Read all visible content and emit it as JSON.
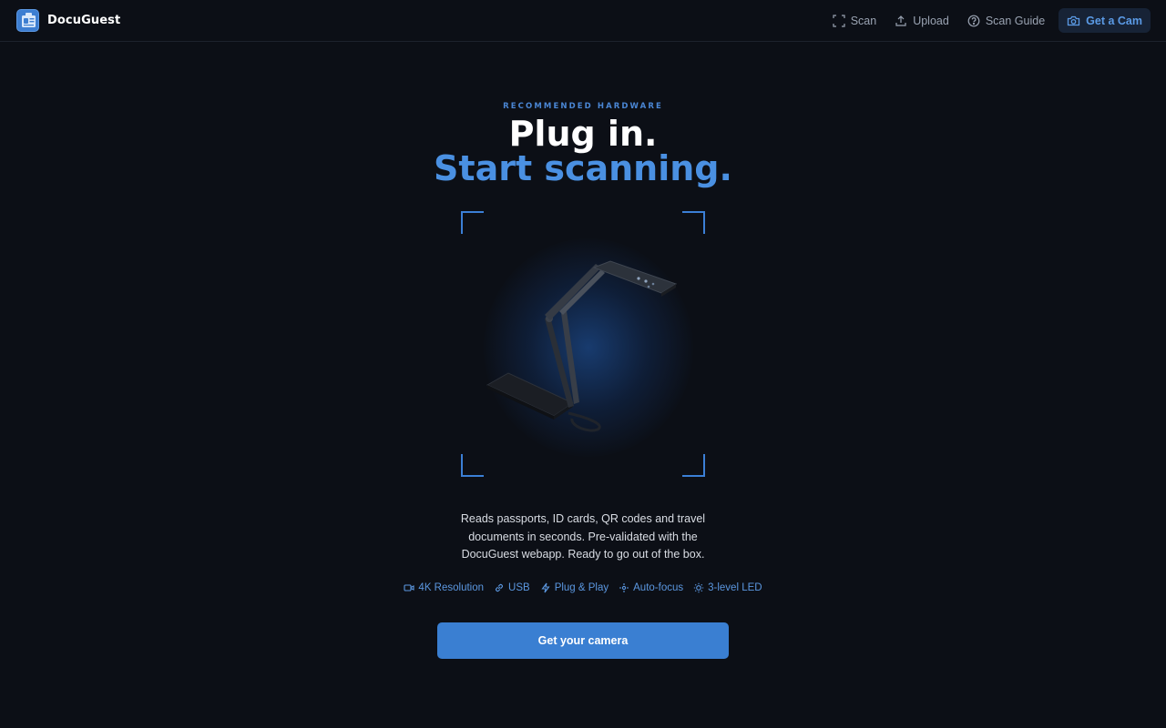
{
  "app": {
    "name": "DocuGuest",
    "logo_icon": "id-card-icon"
  },
  "nav": {
    "items": [
      {
        "label": "Scan",
        "icon": "scan-frame-icon"
      },
      {
        "label": "Upload",
        "icon": "upload-icon"
      },
      {
        "label": "Scan Guide",
        "icon": "help-circle-icon"
      }
    ],
    "cta": {
      "label": "Get a Cam",
      "icon": "camera-icon"
    }
  },
  "hero": {
    "eyebrow": "RECOMMENDED HARDWARE",
    "headline_line1": "Plug in.",
    "headline_line2": "Start scanning.",
    "description": "Reads passports, ID cards, QR codes and travel documents in seconds. Pre-validated with the DocuGuest webapp. Ready to go out of the box.",
    "features": [
      {
        "label": "4K Resolution",
        "icon": "video-icon"
      },
      {
        "label": "USB",
        "icon": "link-icon"
      },
      {
        "label": "Plug & Play",
        "icon": "lightning-icon"
      },
      {
        "label": "Auto-focus",
        "icon": "focus-icon"
      },
      {
        "label": "3-level LED",
        "icon": "sun-icon"
      }
    ],
    "button": "Get your camera"
  },
  "colors": {
    "background": "#0c0f16",
    "accent": "#4a90e2",
    "button": "#3a7fd2"
  }
}
